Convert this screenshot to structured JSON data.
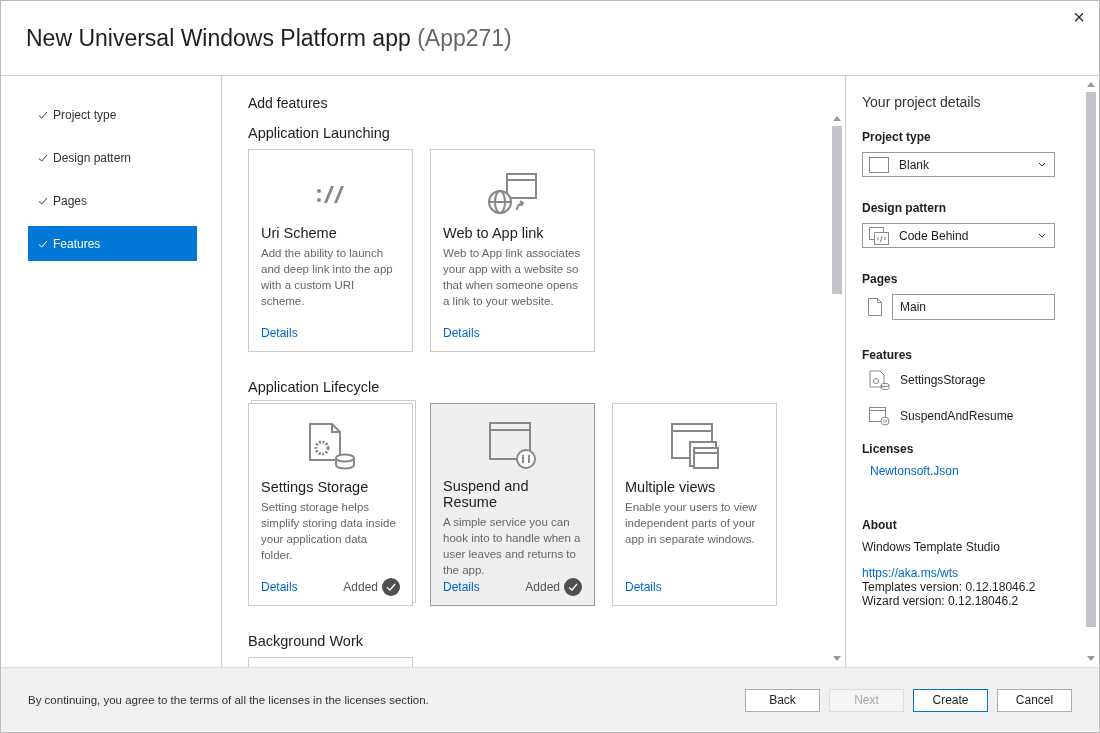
{
  "window": {
    "title": "New Universal Windows Platform app",
    "subtitle": "(App271)",
    "close": "×"
  },
  "steps": [
    {
      "label": "Project type",
      "done": true,
      "selected": false
    },
    {
      "label": "Design pattern",
      "done": true,
      "selected": false
    },
    {
      "label": "Pages",
      "done": true,
      "selected": false
    },
    {
      "label": "Features",
      "done": true,
      "selected": true
    }
  ],
  "main": {
    "heading": "Add features",
    "sections": [
      {
        "title": "Application Launching",
        "cards": [
          {
            "kind": "uri",
            "title": "Uri Scheme",
            "description": "Add the ability to launch and deep link into the app with a custom URI scheme.",
            "link": "Details",
            "added": false,
            "selected": false
          },
          {
            "kind": "web",
            "title": "Web to App link",
            "description": "Web to App link associates your app with a website so that when someone opens a link to your website.",
            "link": "Details",
            "added": false,
            "selected": false
          }
        ]
      },
      {
        "title": "Application Lifecycle",
        "cards": [
          {
            "kind": "settings",
            "title": "Settings Storage",
            "description": "Setting storage helps simplify storing data inside your application data folder.",
            "link": "Details",
            "added": true,
            "added_label": "Added",
            "selected": false
          },
          {
            "kind": "suspend",
            "title": "Suspend and Resume",
            "description": "A simple service you can hook into to handle when a user leaves and returns to the app.",
            "link": "Details",
            "added": true,
            "added_label": "Added",
            "selected": true
          },
          {
            "kind": "views",
            "title": "Multiple views",
            "description": "Enable your users to view independent parts of your app in separate windows.",
            "link": "Details",
            "added": false,
            "selected": false
          }
        ]
      },
      {
        "title": "Background Work",
        "cards": [
          {
            "kind": "blank"
          }
        ]
      }
    ]
  },
  "details": {
    "heading": "Your project details",
    "project_type": {
      "label": "Project type",
      "value": "Blank"
    },
    "design_pattern": {
      "label": "Design pattern",
      "value": "Code Behind"
    },
    "pages": {
      "label": "Pages",
      "items": [
        "Main"
      ]
    },
    "features": {
      "label": "Features",
      "items": [
        {
          "kind": "settings",
          "name": "SettingsStorage"
        },
        {
          "kind": "suspend",
          "name": "SuspendAndResume"
        }
      ]
    },
    "licenses": {
      "label": "Licenses",
      "items": [
        "Newtonsoft.Json"
      ]
    },
    "about": {
      "label": "About",
      "product": "Windows Template Studio",
      "link": "https://aka.ms/wts",
      "lines": [
        "Templates version: 0.12.18046.2",
        "Wizard version: 0.12.18046.2"
      ]
    }
  },
  "footer": {
    "note": "By continuing, you agree to the terms of all the licenses in the licenses section.",
    "buttons": [
      {
        "label": "Back",
        "disabled": false,
        "primary": false
      },
      {
        "label": "Next",
        "disabled": true,
        "primary": false
      },
      {
        "label": "Create",
        "disabled": false,
        "primary": true
      },
      {
        "label": "Cancel",
        "disabled": false,
        "primary": false
      }
    ]
  }
}
